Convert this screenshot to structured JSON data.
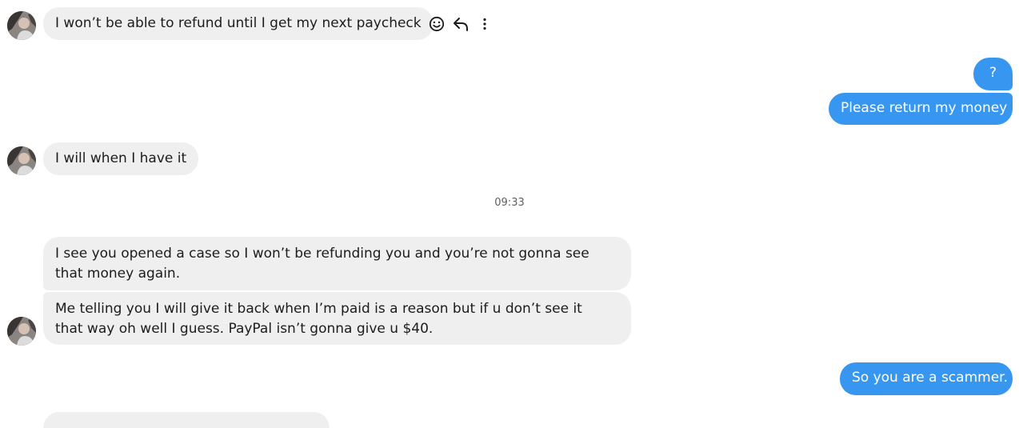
{
  "icons": {
    "react": "emoji-smile-icon",
    "reply": "reply-icon",
    "more": "more-vertical-icon"
  },
  "colors": {
    "incoming_bubble": "#efefef",
    "outgoing_bubble": "#3797f0",
    "text_dark": "#1c1c1c",
    "timestamp": "#5f5f5f"
  },
  "messages": {
    "m1": "I won’t be able to refund until I get my next paycheck",
    "m2": "?",
    "m3": "Please return my money",
    "m4": "I will when I have it",
    "m5": "I see you opened a case so I won’t be refunding you and you’re not gonna see that money again.",
    "m6": "Me telling you I will give it back when I’m paid is a reason but if u don’t see it that way oh well I guess. PayPal isn’t gonna give u $40.",
    "m7": "So you are a scammer."
  },
  "timestamp": "09:33"
}
